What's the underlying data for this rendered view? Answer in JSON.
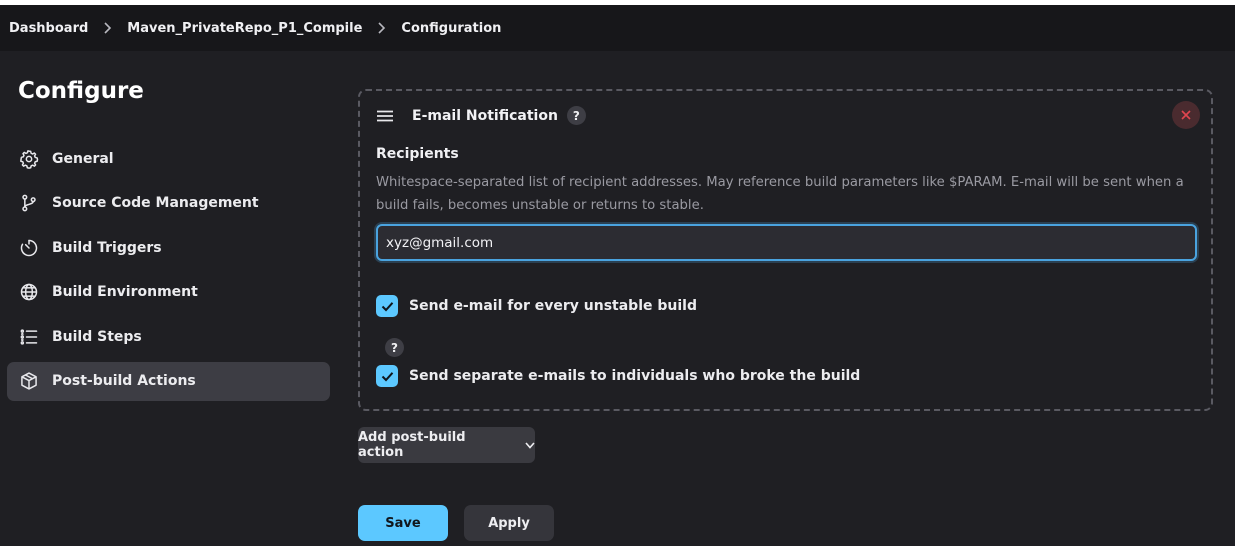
{
  "breadcrumb": {
    "items": [
      "Dashboard",
      "Maven_PrivateRepo_P1_Compile",
      "Configuration"
    ]
  },
  "page_title": "Configure",
  "sidebar": {
    "items": [
      {
        "label": "General",
        "icon": "gear-icon",
        "active": false
      },
      {
        "label": "Source Code Management",
        "icon": "git-branch-icon",
        "active": false
      },
      {
        "label": "Build Triggers",
        "icon": "timer-icon",
        "active": false
      },
      {
        "label": "Build Environment",
        "icon": "globe-icon",
        "active": false
      },
      {
        "label": "Build Steps",
        "icon": "list-icon",
        "active": false
      },
      {
        "label": "Post-build Actions",
        "icon": "package-icon",
        "active": true
      }
    ]
  },
  "section_header": "Post-build Actions",
  "email_notification": {
    "title": "E-mail Notification",
    "help": "?",
    "recipients_label": "Recipients",
    "recipients_description": "Whitespace-separated list of recipient addresses. May reference build parameters like $PARAM. E-mail will be sent when a build fails, becomes unstable or returns to stable.",
    "recipients_value": "xyz@gmail.com",
    "checkbox_unstable": {
      "label": "Send e-mail for every unstable build",
      "checked": true
    },
    "checkbox_separate": {
      "label": "Send separate e-mails to individuals who broke the build",
      "checked": true
    }
  },
  "add_action_label": "Add post-build action",
  "buttons": {
    "save": "Save",
    "apply": "Apply"
  },
  "colors": {
    "accent": "#5cc8ff",
    "background": "#1f1f23",
    "topbar": "#17171a",
    "active_item": "#3d3d44",
    "danger": "#e0454f"
  }
}
